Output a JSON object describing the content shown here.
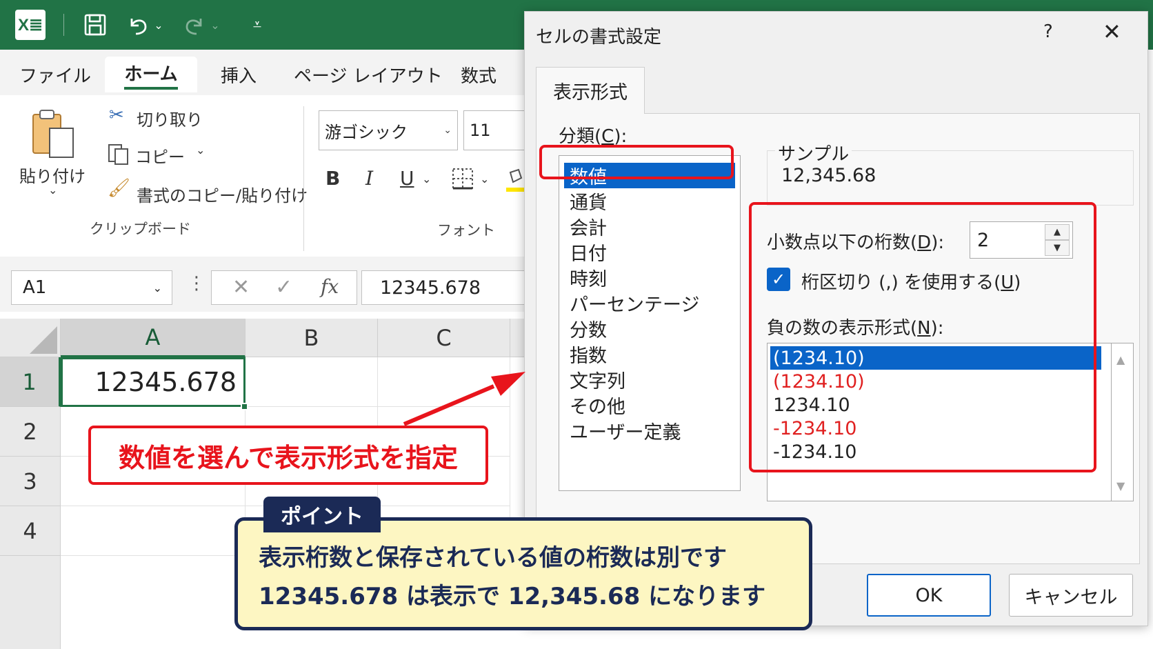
{
  "app": {
    "logo": "X≣",
    "title_icons": [
      "save-icon",
      "undo-icon",
      "redo-icon",
      "customize-icon"
    ]
  },
  "ribbon": {
    "tabs": [
      {
        "label": "ファイル"
      },
      {
        "label": "ホーム",
        "active": true
      },
      {
        "label": "挿入"
      },
      {
        "label": "ページ レイアウト"
      },
      {
        "label": "数式"
      }
    ],
    "clipboard": {
      "paste": "貼り付け",
      "cut": "切り取り",
      "copy": "コピー",
      "format_painter": "書式のコピー/貼り付け",
      "group_label": "クリップボード"
    },
    "font": {
      "name": "游ゴシック",
      "size": "11",
      "bold": "B",
      "italic": "I",
      "underline": "U",
      "group_label": "フォント"
    }
  },
  "formula_bar": {
    "name_box": "A1",
    "fx": "fx",
    "value": "12345.678"
  },
  "sheet": {
    "columns": [
      "A",
      "B",
      "C"
    ],
    "rows": [
      "1",
      "2",
      "3",
      "4"
    ],
    "a1_value": "12345.678"
  },
  "dialog": {
    "title": "セルの書式設定",
    "help": "?",
    "close": "✕",
    "tab": "表示形式",
    "category_label": "分類(",
    "category_key": "C",
    "category_suffix": "):",
    "categories": [
      "数値",
      "通貨",
      "会計",
      "日付",
      "時刻",
      "パーセンテージ",
      "分数",
      "指数",
      "文字列",
      "その他",
      "ユーザー定義"
    ],
    "selected_category": "数値",
    "sample_label": "サンプル",
    "sample_value": "12,345.68",
    "decimal_label": "小数点以下の桁数(",
    "decimal_key": "D",
    "decimal_suffix": "):",
    "decimal_value": "2",
    "separator_label": "桁区切り (,) を使用する(",
    "separator_key": "U",
    "separator_suffix": ")",
    "separator_checked": true,
    "negative_label": "負の数の表示形式(",
    "negative_key": "N",
    "negative_suffix": "):",
    "negative_formats": [
      {
        "text": "(1234.10)",
        "color": "black",
        "selected": true
      },
      {
        "text": "(1234.10)",
        "color": "red"
      },
      {
        "text": "1234.10",
        "color": "black"
      },
      {
        "text": "-1234.10",
        "color": "red"
      },
      {
        "text": "-1234.10",
        "color": "black"
      }
    ],
    "ok": "OK",
    "cancel": "キャンセル"
  },
  "annotations": {
    "callout": "数値を選んで表示形式を指定",
    "point_tag": "ポイント",
    "point_line1": "表示桁数と保存されている値の桁数は別です",
    "point_line2": "12345.678 は表示で 12,345.68 になります"
  },
  "colors": {
    "excel_green": "#217346",
    "selection_blue": "#0a64c8",
    "annotation_red": "#e8141c",
    "point_navy": "#1b2a56",
    "point_fill": "#fdf6c2"
  }
}
